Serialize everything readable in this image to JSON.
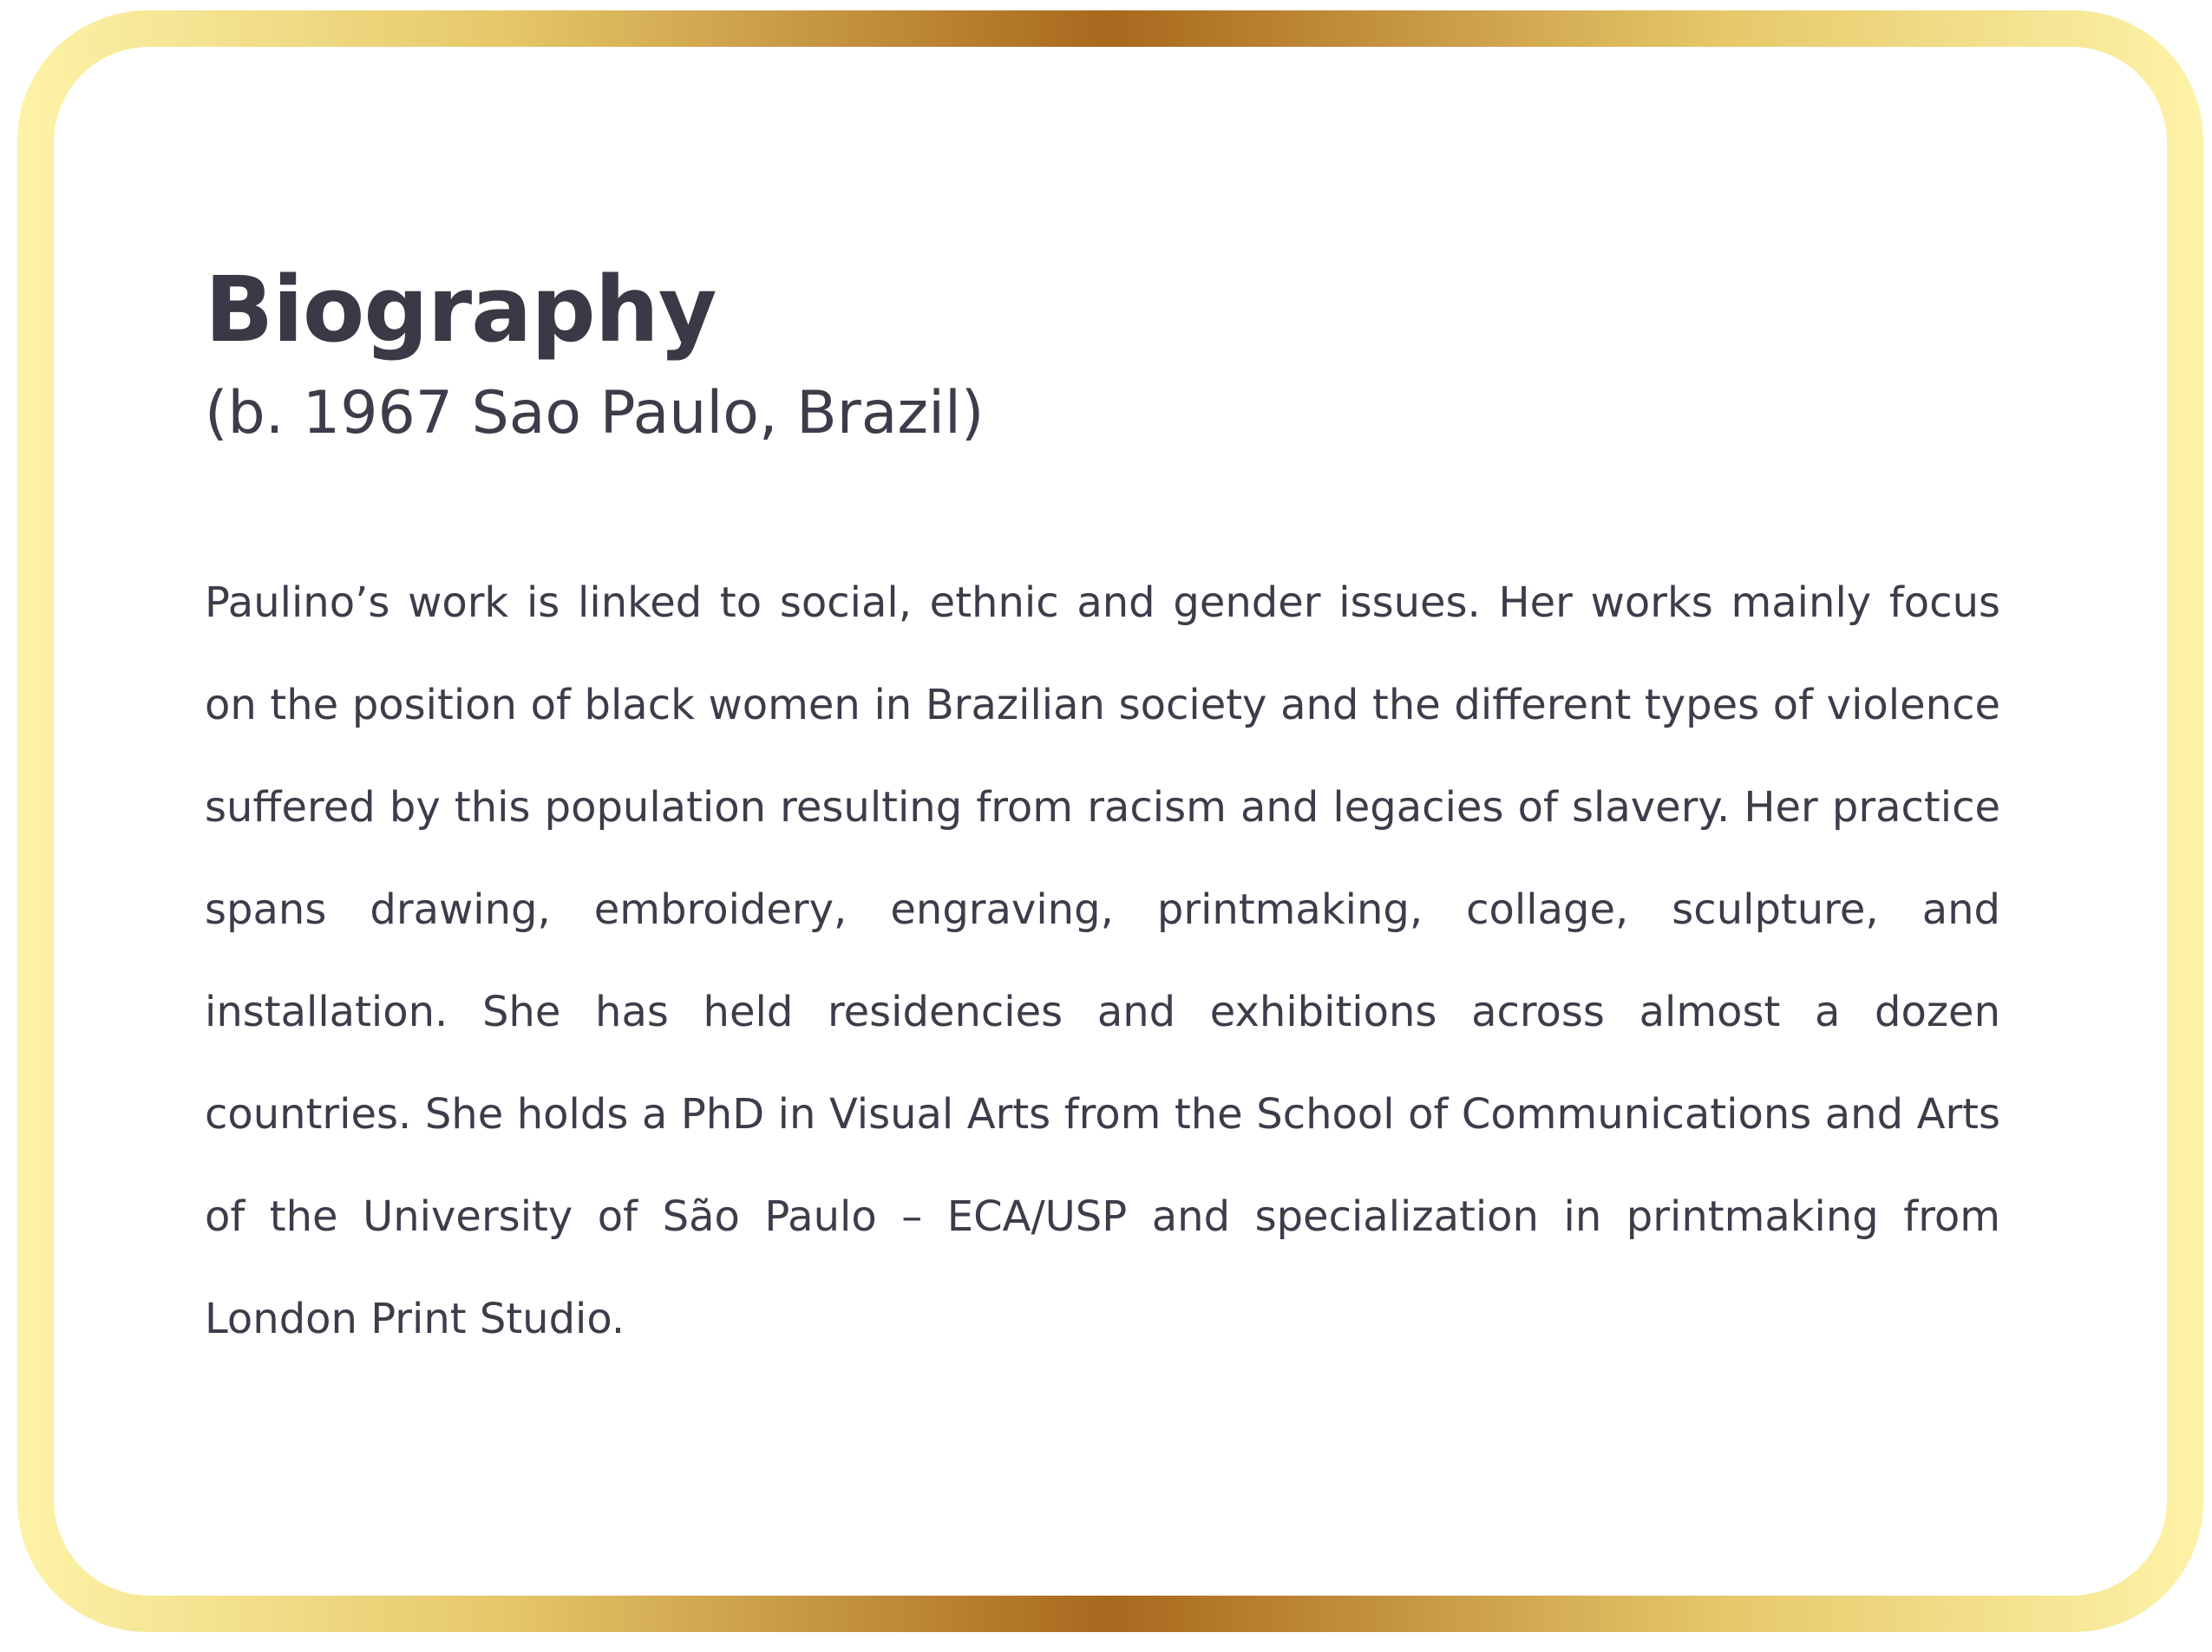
{
  "card": {
    "title": "Biography",
    "subtitle": "(b. 1967 Sao Paulo, Brazil)",
    "body": "Paulino’s work is linked to social, ethnic and gender issues. Her works mainly focus on the position of black women in Brazilian society and the different types of violence suffered by this population resulting from racism and legacies of slavery. Her practice spans drawing, embroidery, engraving, printmaking, collage, sculpture, and installation. She has held residencies and exhibitions across almost a dozen countries. She holds a PhD in Visual Arts from the School of Communications and Arts of the University of São Paulo – ECA/USP and specialization in printmaking from London Print Studio."
  },
  "colors": {
    "border_gradient": [
      "#fdf3a8",
      "#e6c86a",
      "#a8681d"
    ],
    "text": "#3d3c4a",
    "background": "#ffffff"
  }
}
